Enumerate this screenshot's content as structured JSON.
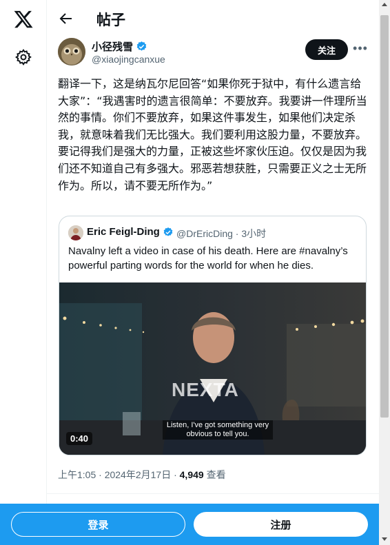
{
  "header": {
    "title": "帖子"
  },
  "author": {
    "name": "小径残雪",
    "handle": "@xiaojingcanxue",
    "follow_label": "关注",
    "more_label": "•••"
  },
  "tweet": {
    "text": "翻译一下，这是纳瓦尔尼回答“如果你死于狱中，有什么遗言给大家”：“我遇害时的遗言很简单：不要放弃。我要讲一件理所当然的事情。你们不要放弃，如果这件事发生，如果他们决定杀我，就意味着我们无比强大。我们要利用这股力量，不要放弃。要记得我们是强大的力量，正被这些坏家伙压迫。仅仅是因为我们还不知道自己有多强大。邪恶若想获胜，只需要正义之士无所作为。所以，请不要无所作为。”"
  },
  "quote": {
    "name": "Eric Feigl-Ding",
    "meta": "@DrEricDing · 3小时",
    "text": "Navalny left a video in case of his death. Here are #navalny’s powerful parting words for the world for when he dies.",
    "video": {
      "watermark": "NEXTA",
      "caption": "Listen, I've got something very obvious to tell you.",
      "duration": "0:40"
    }
  },
  "timeline": {
    "time": "上午1:05 · 2024年2月17日 · ",
    "views": "4,949",
    "views_label": " 查看"
  },
  "bottom": {
    "login_label": "登录",
    "signup_label": "注册"
  },
  "colors": {
    "accent": "#1d9bf0",
    "verified": "#1d9bf0",
    "text": "#0f1419",
    "secondary": "#536471"
  }
}
